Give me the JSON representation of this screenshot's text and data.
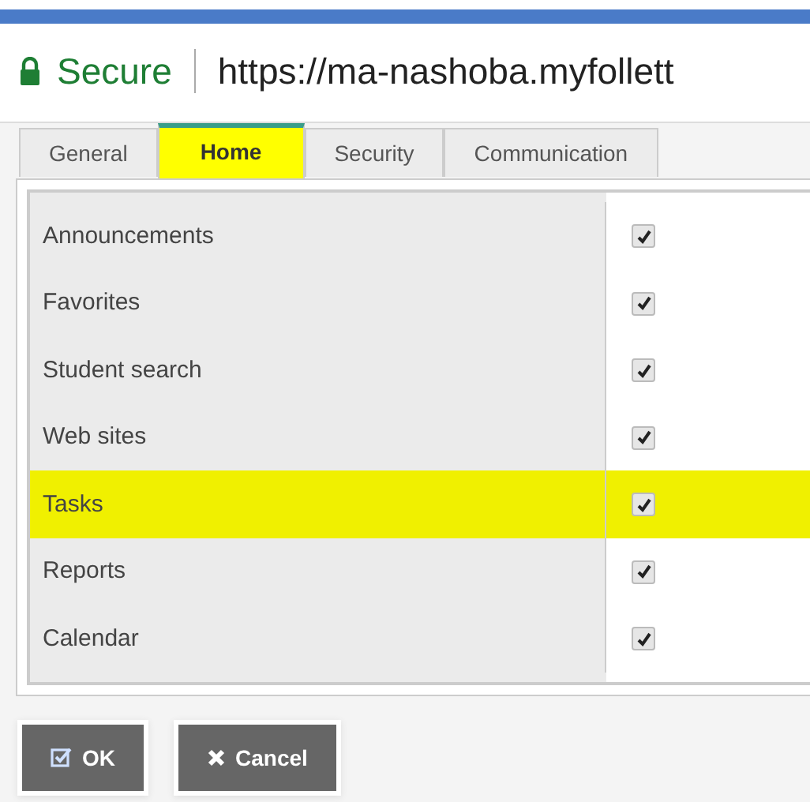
{
  "address_bar": {
    "secure_label": "Secure",
    "url": "https://ma-nashoba.myfollett"
  },
  "tabs": [
    {
      "label": "General",
      "selected": false,
      "highlighted": false
    },
    {
      "label": "Home",
      "selected": true,
      "highlighted": true
    },
    {
      "label": "Security",
      "selected": false,
      "highlighted": false
    },
    {
      "label": "Communication",
      "selected": false,
      "highlighted": false
    }
  ],
  "settings": [
    {
      "label": "Announcements",
      "checked": true,
      "highlighted": false
    },
    {
      "label": "Favorites",
      "checked": true,
      "highlighted": false
    },
    {
      "label": "Student search",
      "checked": true,
      "highlighted": false
    },
    {
      "label": "Web sites",
      "checked": true,
      "highlighted": false
    },
    {
      "label": "Tasks",
      "checked": true,
      "highlighted": true
    },
    {
      "label": "Reports",
      "checked": true,
      "highlighted": false
    },
    {
      "label": "Calendar",
      "checked": true,
      "highlighted": false
    }
  ],
  "buttons": [
    {
      "kind": "ok",
      "label": "OK"
    },
    {
      "kind": "cancel",
      "label": "Cancel"
    }
  ]
}
